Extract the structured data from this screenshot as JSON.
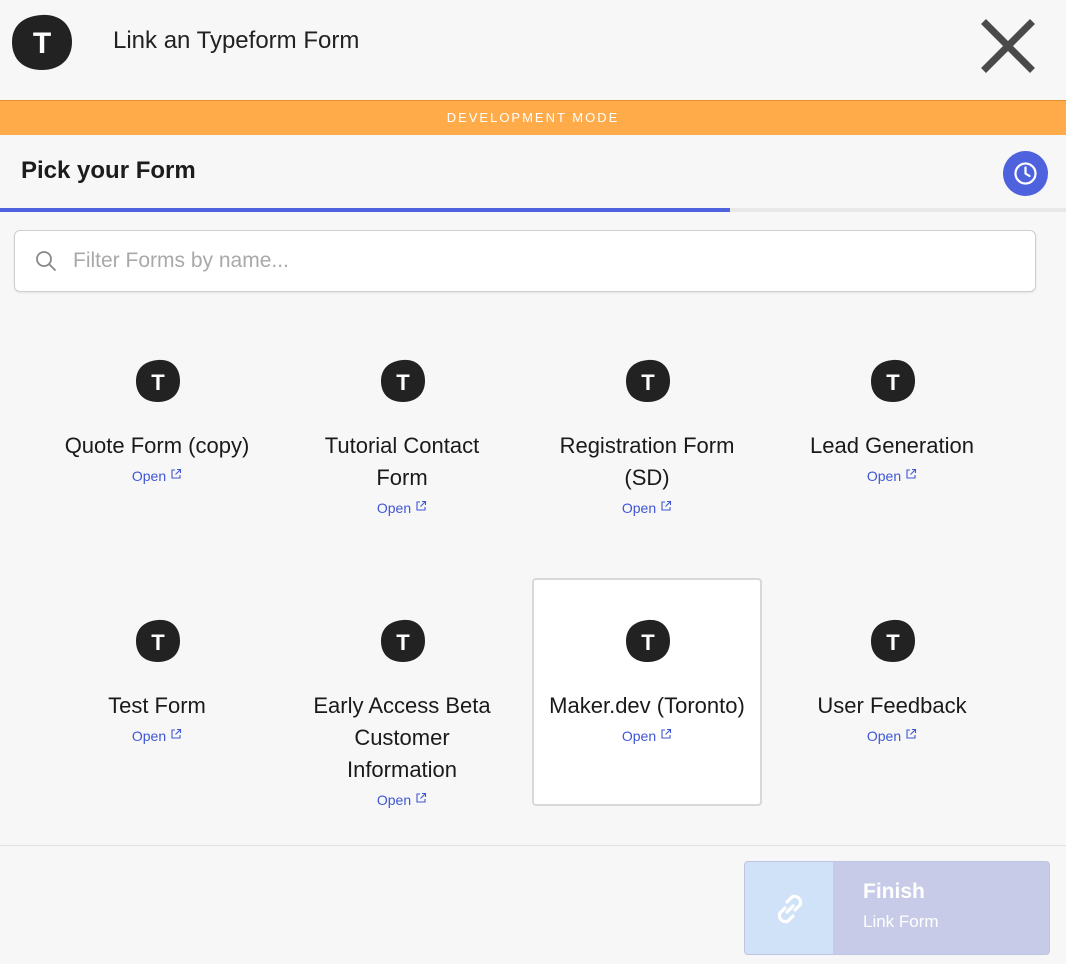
{
  "header": {
    "title": "Link an Typeform Form",
    "logo_icon": "typeform-logo-icon",
    "close_icon": "close-icon"
  },
  "banner": {
    "text": "DEVELOPMENT MODE",
    "color": "#ffab4a"
  },
  "section": {
    "title": "Pick your Form",
    "history_icon": "clock-icon",
    "progress_fraction": 0.685
  },
  "search": {
    "placeholder": "Filter Forms by name...",
    "value": "",
    "icon": "search-icon"
  },
  "forms": [
    {
      "name": "Quote Form (copy)",
      "link": "Open",
      "selected": false
    },
    {
      "name": "Tutorial Contact Form",
      "link": "Open",
      "selected": false
    },
    {
      "name": "Registration Form (SD)",
      "link": "Open",
      "selected": false
    },
    {
      "name": "Lead Generation",
      "link": "Open",
      "selected": false
    },
    {
      "name": "Test Form",
      "link": "Open",
      "selected": false
    },
    {
      "name": "Early Access Beta Customer Information",
      "link": "Open",
      "selected": false
    },
    {
      "name": "Maker.dev (Toronto)",
      "link": "Open",
      "selected": true
    },
    {
      "name": "User Feedback",
      "link": "Open",
      "selected": false
    }
  ],
  "footer": {
    "finish_title": "Finish",
    "finish_subtitle": "Link Form",
    "finish_icon": "link-icon",
    "disabled": true
  },
  "colors": {
    "accent": "#4e62dd",
    "link": "#3f56d6",
    "banner": "#ffab4a"
  }
}
